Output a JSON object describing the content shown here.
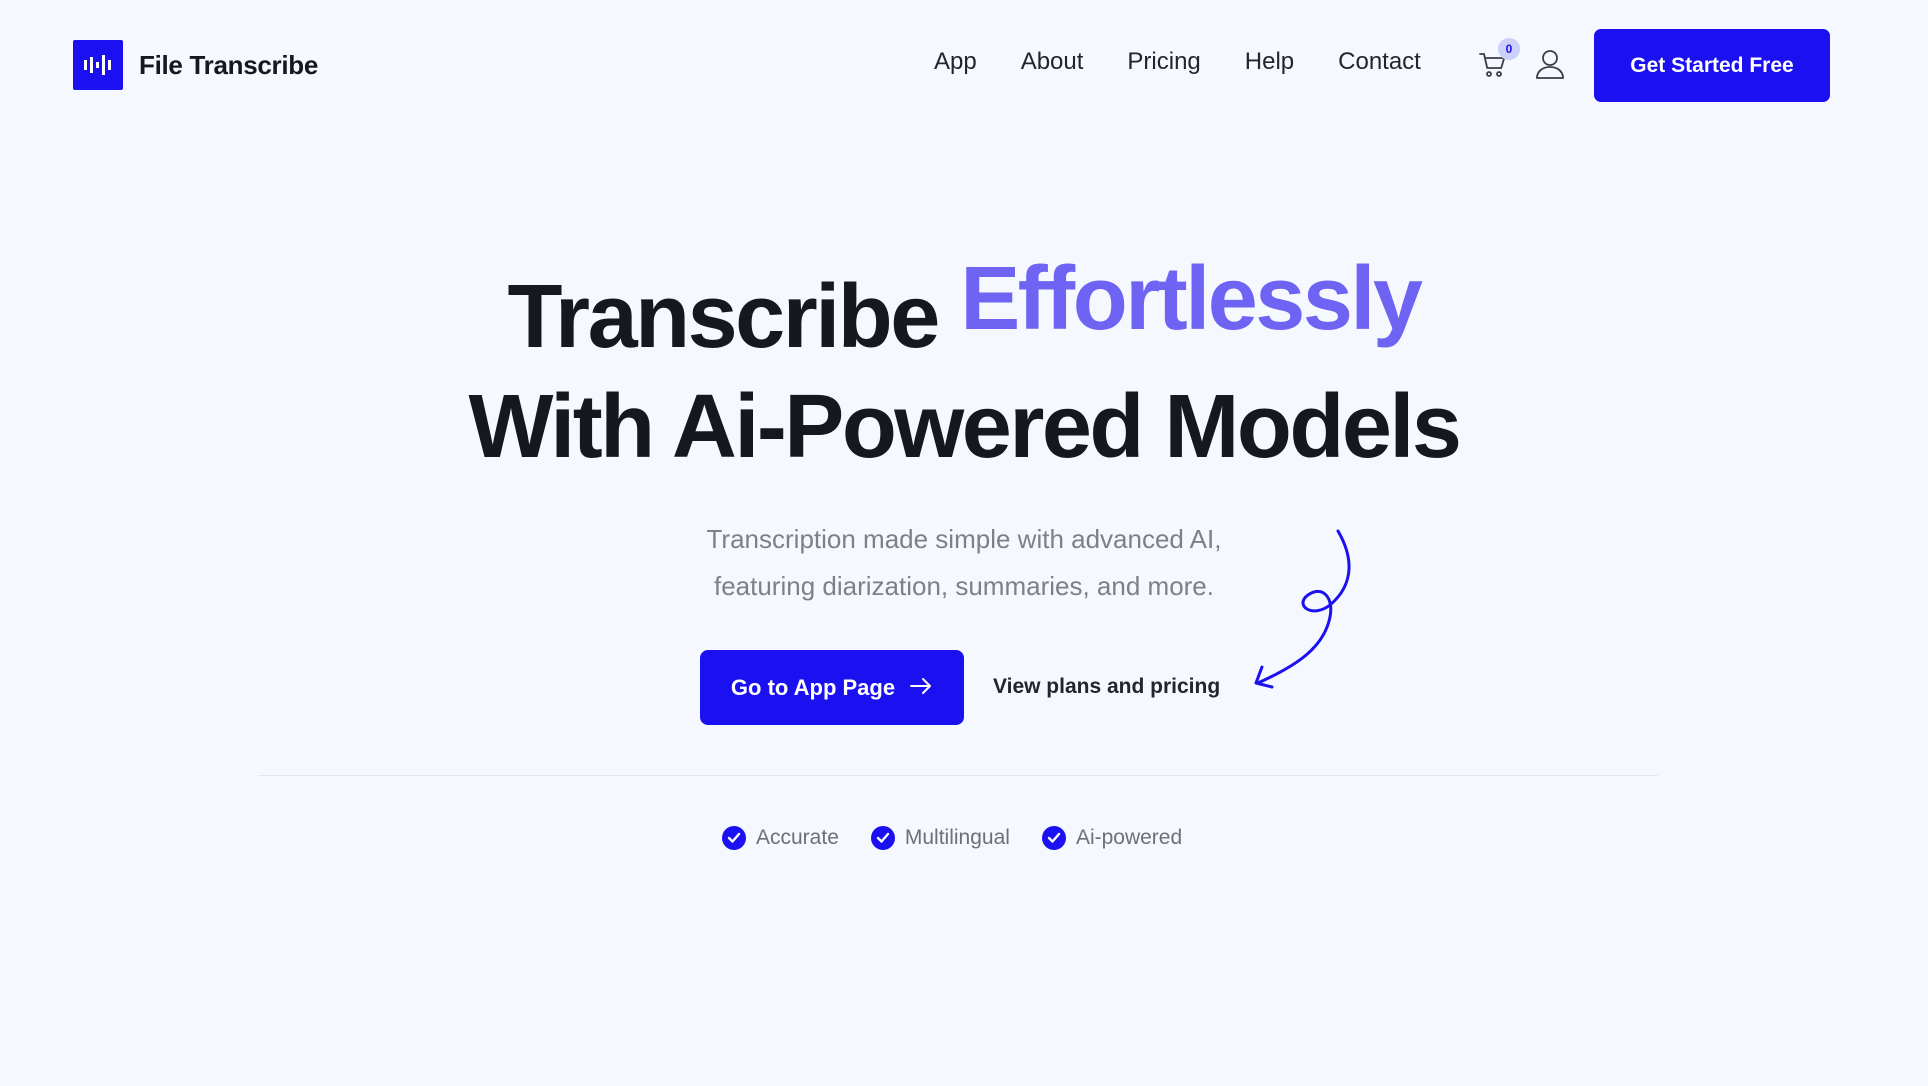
{
  "brand": {
    "name": "File Transcribe",
    "logo_icon": "audio-waveform-icon",
    "color": "#1a10f0"
  },
  "nav": {
    "items": [
      "App",
      "About",
      "Pricing",
      "Help",
      "Contact"
    ],
    "cart_count": "0",
    "cart_icon": "shopping-cart-icon",
    "user_icon": "user-account-icon",
    "cta_label": "Get Started Free"
  },
  "hero": {
    "title_word": "Transcribe",
    "title_accent": "Effortlessly",
    "title_line2": "With Ai-Powered Models",
    "subtitle_line1": "Transcription made simple with advanced AI,",
    "subtitle_line2": "featuring diarization, summaries, and more.",
    "primary_button": "Go to App Page",
    "primary_button_icon": "arrow-right-icon",
    "secondary_link": "View plans and pricing",
    "decoration_icon": "curly-arrow-icon"
  },
  "features": [
    {
      "label": "Accurate",
      "icon": "check-circle-icon"
    },
    {
      "label": "Multilingual",
      "icon": "check-circle-icon"
    },
    {
      "label": "Ai-powered",
      "icon": "check-circle-icon"
    }
  ],
  "colors": {
    "background": "#f5f8fe",
    "primary": "#1a10f0",
    "accent_text": "#6e63f2",
    "heading": "#16181d",
    "muted_text": "#7d8088"
  }
}
